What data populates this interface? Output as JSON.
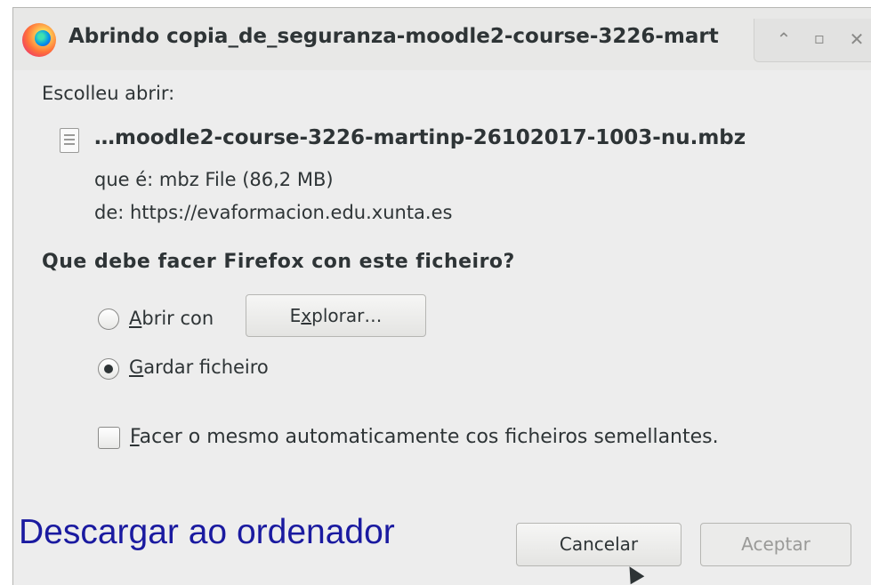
{
  "window": {
    "title": "Abrindo copia_de_seguranza-moodle2-course-3226-mart",
    "buttons": {
      "minimize": "⌃",
      "maximize": "▫",
      "close": "✕"
    }
  },
  "content": {
    "choose_label": "Escolleu abrir:",
    "file_name": "…moodle2-course-3226-martinp-26102017-1003-nu.mbz",
    "file_type": "que é: mbz File (86,2 MB)",
    "file_from": "de: https://evaformacion.edu.xunta.es",
    "question": "Que debe facer Firefox con este ficheiro?",
    "options": [
      {
        "accel": "A",
        "rest": "brir con",
        "selected": false
      },
      {
        "accel": "G",
        "rest": "ardar ficheiro",
        "selected": true
      }
    ],
    "browse_button": {
      "before": "E",
      "accel": "x",
      "after": "plorar…"
    },
    "auto_checkbox": {
      "accel": "F",
      "rest": "acer o mesmo automaticamente cos ficheiros semellantes.",
      "checked": false
    }
  },
  "overlay_caption": "Descargar ao ordenador",
  "footer": {
    "cancel_label": "Cancelar",
    "accept_label": "Aceptar"
  },
  "colors": {
    "dialog_bg": "#ededed",
    "caption": "#1a1aa0",
    "disabled_text": "#9a9a98"
  }
}
